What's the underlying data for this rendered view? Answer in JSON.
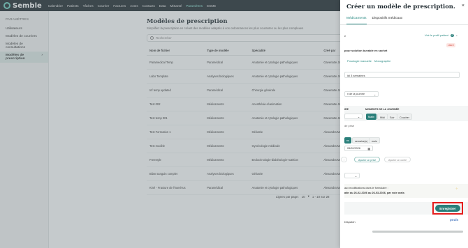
{
  "app": {
    "logo_text": "Semble"
  },
  "topnav": {
    "items": [
      "Calendrier",
      "Patients",
      "Tâches",
      "Courrier",
      "Factures",
      "Actes",
      "Contacts",
      "Data",
      "MiSanté",
      "Paramètres",
      "ESME"
    ],
    "active_index": 9
  },
  "sidebar": {
    "heading": "PARAMÈTRES",
    "items": [
      {
        "label": "Utilisateurs",
        "active": false
      },
      {
        "label": "Modèles de courriers",
        "active": false
      },
      {
        "label": "Modèles de consultations",
        "active": false
      },
      {
        "label": "Modèles de prescription",
        "active": true,
        "chevron": "›"
      }
    ]
  },
  "main": {
    "title": "Modèles de prescription",
    "subtitle": "Simplifiez la prescription en créant des modèles adaptés à vos ordonnances les plus courantes ou les plus complexes",
    "search_placeholder": "Rechercher",
    "columns": [
      "Nom de fichier",
      "Type de modèle",
      "Spécialité",
      "Créé par",
      "Date"
    ],
    "rows": [
      [
        "Paramedical Temp",
        "Paramédical",
        "Anatomie et cytologie pathologiques",
        "Gavenatte James",
        "24/02"
      ],
      [
        "Labo Template",
        "Analyses biologiques",
        "Anatomie et cytologie pathologiques",
        "Gavenatte James",
        "24/02"
      ],
      [
        "Inf temp updated",
        "Paramédical",
        "Chirurgie générale",
        "Gavenatte James",
        "24/02"
      ],
      [
        "Test 002",
        "Médicaments",
        "Anesthésie-réanimation",
        "Gavenatte James",
        "24/02"
      ],
      [
        "Test temp 001",
        "Médicaments",
        "Anatomie et cytologie pathologiques",
        "Gavenatte James",
        "24/02"
      ],
      [
        "Test Formation 1",
        "Médicaments",
        "Gériatrie",
        "Alexandra Manon",
        "20/02"
      ],
      [
        "Test modèle",
        "Médicaments",
        "Gynécologie médicale",
        "Alexandra Manon",
        "20/02"
      ],
      [
        "Freestyle",
        "Médicaments",
        "Endocrinologie-diabétologie-nutrition",
        "Alexandra Manon",
        "20/02"
      ],
      [
        "Bilan sanguin complet",
        "Analyses biologiques",
        "Gériatrie",
        "Alexandra Manon",
        "20/02"
      ],
      [
        "Kiné - Fracture de l'humérus",
        "Paramédical",
        "Anatomie et cytologie pathologiques",
        "Alexandra Manon",
        "20/02"
      ]
    ],
    "pager": {
      "label": "Lignes par page:",
      "per_page": "10",
      "range": "1 - 10 sur 28"
    }
  },
  "panel": {
    "title": "Créer un modèle de prescription.",
    "close": "×",
    "tabs": [
      "Médicaments",
      "Dispositifs médicaux"
    ],
    "active_tab": 0,
    "row_e": "e",
    "profile_link": "Voir le profil patient",
    "profile_count": "0",
    "badge": "Liste I",
    "drug_line": "pour solution buvable en sachet",
    "posology_link": "Posologie manuelle",
    "monograph_link": "Monographie",
    "duration_value": "idi 3 semaines",
    "frequency_select": "n de la journée",
    "col_left_label": "IRE",
    "col_right_label": "MOMENTS DE LA JOURNÉE",
    "moments": [
      "Matin",
      "Midi",
      "Soir",
      "Coucher"
    ],
    "active_moment": 0,
    "de_prise": "de prise",
    "unit_short": "ns",
    "units": [
      "semaine(s)",
      "mois"
    ],
    "start_date": "05/02/2026",
    "add_button": "Ajouter un prisé",
    "add_note_button": "Ajouter un conté",
    "summary_label": "aux modifications dans le formulaire :",
    "summary_text": "atin du 26-02-2026 au 26-03-2026, par voie orale.",
    "footer_text": "Dispatch",
    "save_button": "Enregistrer",
    "brand": "pouls"
  }
}
